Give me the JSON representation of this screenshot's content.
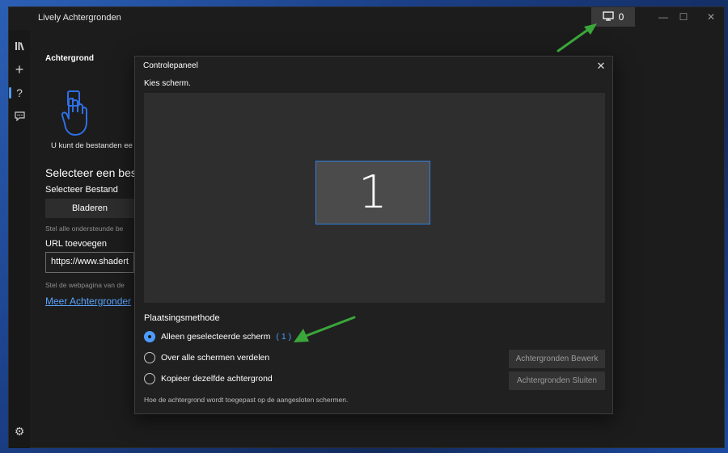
{
  "window": {
    "title": "Lively Achtergronden",
    "screen_button_count": "0",
    "controls": {
      "minimize": "—",
      "maximize": "☐",
      "close": "✕"
    }
  },
  "rail": {
    "icons": [
      "library-icon",
      "add-icon",
      "help-icon",
      "feedback-icon",
      "settings-icon"
    ],
    "glyphs": {
      "add": "+",
      "help": "?",
      "settings": "⚙"
    }
  },
  "page": {
    "heading": "Achtergrond",
    "drop_hint": "U kunt de bestanden ee",
    "select_heading": "Selecteer een best",
    "select_file_label": "Selecteer Bestand",
    "browse_button": "Bladeren",
    "formats_hint": "Stel alle ondersteunde be",
    "url_label": "URL toevoegen",
    "url_value": "https://www.shadert",
    "web_hint": "Stel de webpagina van de",
    "more_link": "Meer Achtergronder"
  },
  "dialog": {
    "title": "Controlepaneel",
    "close_glyph": "✕",
    "choose_screen_label": "Kies scherm.",
    "monitor_number": "1",
    "placement_title": "Plaatsingsmethode",
    "options": [
      {
        "label": "Alleen geselecteerde scherm",
        "count": "( 1 )",
        "checked": true
      },
      {
        "label": "Over alle schermen verdelen",
        "checked": false
      },
      {
        "label": "Kopieer dezelfde achtergrond",
        "checked": false
      }
    ],
    "edit_button": "Achtergronden Bewerk",
    "close_button": "Achtergronden Sluiten",
    "help_text": "Hoe de achtergrond wordt toegepast op de aangesloten schermen."
  },
  "colors": {
    "accent": "#4d9bff",
    "window_bg": "#1c1c1c",
    "dialog_bg": "#202020",
    "annotation_arrow": "#3aa63a"
  }
}
